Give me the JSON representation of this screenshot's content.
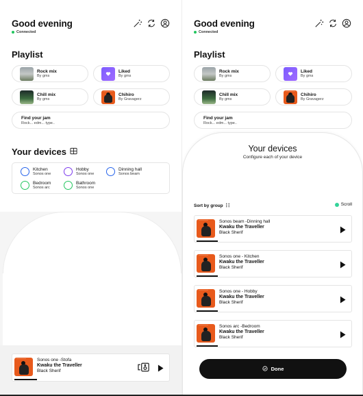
{
  "header": {
    "greeting": "Good evening",
    "status": "Connected"
  },
  "playlist": {
    "title": "Playlist",
    "items": [
      {
        "title": "Rock mix",
        "sub": "By gms",
        "thumb": "rock"
      },
      {
        "title": "Liked",
        "sub": "By gms",
        "thumb": "liked"
      },
      {
        "title": "Chill mix",
        "sub": "By gms",
        "thumb": "chill"
      },
      {
        "title": "Chihiro",
        "sub": "By Gravagerz",
        "thumb": "art"
      }
    ],
    "jam": {
      "title": "Find your jam",
      "sub": "Rock... edm... type.."
    }
  },
  "devices": {
    "title": "Your devices",
    "items": [
      {
        "name": "Kitchen",
        "model": "Sonos one",
        "ring": "#2563eb"
      },
      {
        "name": "Hobby",
        "model": "Sonos one",
        "ring": "#7c3aed"
      },
      {
        "name": "Dinning hall",
        "model": "Sonos beam",
        "ring": "#2563eb"
      },
      {
        "name": "Bedroom",
        "model": "Sonos arc",
        "ring": "#22c55e"
      },
      {
        "name": "Bathroom",
        "model": "Sonos one",
        "ring": "#22c55e"
      }
    ]
  },
  "now_playing": {
    "location": "Sonos one -Stofa",
    "song": "Kwaku the Traveller",
    "artist": "Black Sherif"
  },
  "panel": {
    "title": "Your devices",
    "subtitle": "Configure each of your device",
    "sort_label": "Sort by group",
    "scroll_label": "Scroll",
    "cards": [
      {
        "location": "Sonos beam -Dinning hall",
        "song": "Kwaku the Traveller",
        "artist": "Black Sherif"
      },
      {
        "location": "Sonos one - Kitchen",
        "song": "Kwaku the Traveller",
        "artist": "Black Sherif"
      },
      {
        "location": "Sonos one - Hobby",
        "song": "Kwaku the Traveller",
        "artist": "Black Sherif"
      },
      {
        "location": "Sonos arc -Bedroom",
        "song": "Kwaku the Traveller",
        "artist": "Black Sherif"
      }
    ],
    "done_label": "Done"
  },
  "colors": {
    "accent": "#111111",
    "connected": "#22c55e",
    "album": "#e85a1c"
  }
}
